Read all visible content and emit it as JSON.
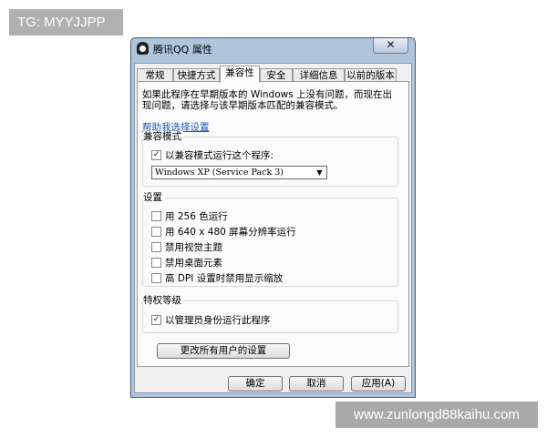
{
  "watermarks": {
    "top_left": "TG: MYYJJPP",
    "bottom_right": "www.zunlongd88kaihu.com"
  },
  "window": {
    "title": "腾讯QQ 属性",
    "close_label": "✕",
    "icon": "qq-penguin-icon"
  },
  "tabs": [
    {
      "label": "常规",
      "active": false
    },
    {
      "label": "快捷方式",
      "active": false
    },
    {
      "label": "兼容性",
      "active": true
    },
    {
      "label": "安全",
      "active": false
    },
    {
      "label": "详细信息",
      "active": false
    },
    {
      "label": "以前的版本",
      "active": false
    }
  ],
  "compat": {
    "intro_line1": "如果此程序在早期版本的 Windows 上没有问题，而现在出",
    "intro_line2": "现问题，请选择与该早期版本匹配的兼容模式。",
    "help_link": "帮助我选择设置",
    "mode_group": {
      "label": "兼容模式",
      "checkbox_label": "以兼容模式运行这个程序:",
      "checked": true,
      "selected_os": "Windows XP (Service Pack 3)"
    },
    "settings_group": {
      "label": "设置",
      "items": [
        {
          "label": "用 256 色运行",
          "checked": false
        },
        {
          "label": "用 640 x 480 屏幕分辨率运行",
          "checked": false
        },
        {
          "label": "禁用视觉主题",
          "checked": false
        },
        {
          "label": "禁用桌面元素",
          "checked": false
        },
        {
          "label": "高 DPI 设置时禁用显示缩放",
          "checked": false
        }
      ]
    },
    "privilege_group": {
      "label": "特权等级",
      "checkbox_label": "以管理员身份运行此程序",
      "checked": true
    },
    "all_users_button": "更改所有用户的设置"
  },
  "buttons": {
    "ok": "确定",
    "cancel": "取消",
    "apply": "应用(A)"
  }
}
